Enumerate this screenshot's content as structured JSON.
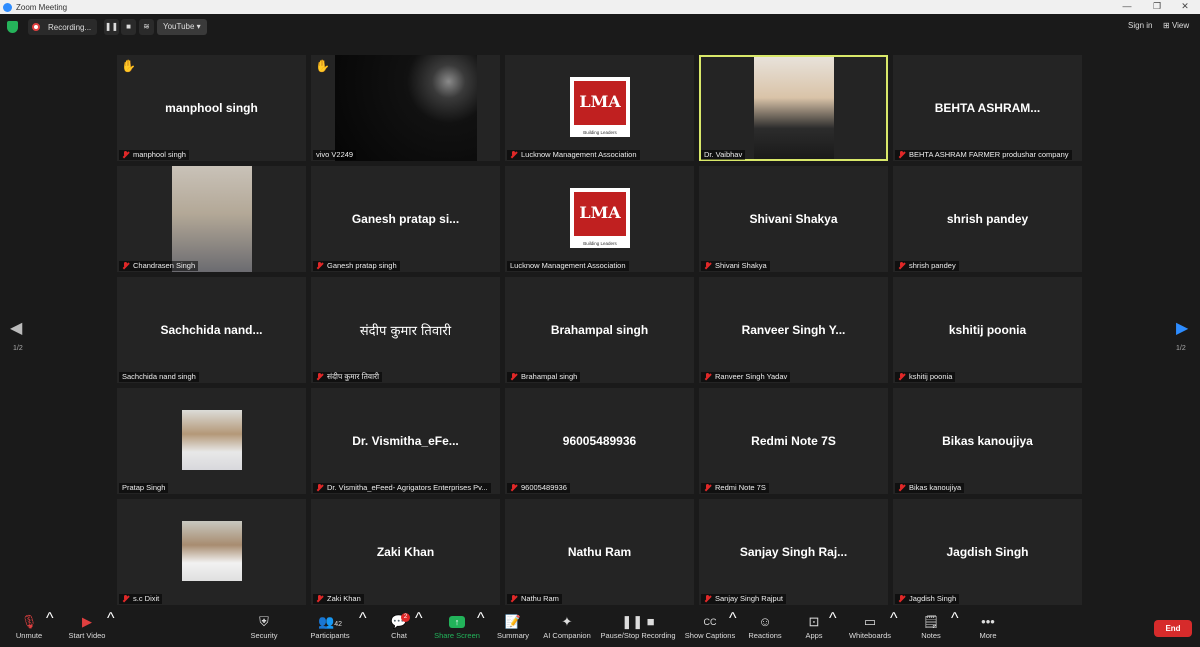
{
  "window": {
    "title": "Zoom Meeting"
  },
  "topbar": {
    "recording_label": "Recording...",
    "stream_label": "YouTube ▾",
    "sign_in": "Sign in",
    "view_label": "View"
  },
  "pager": {
    "left": "1/2",
    "right": "1/2"
  },
  "tiles": [
    {
      "big": "manphool singh",
      "label": "manphool singh",
      "muted": true,
      "hand": true
    },
    {
      "big": "",
      "label": "vivo V2249",
      "muted": false,
      "hand": true
    },
    {
      "big": "",
      "label": "Lucknow Management Association",
      "muted": true,
      "hand": false
    },
    {
      "big": "",
      "label": "Dr. Vaibhav",
      "muted": false,
      "hand": false,
      "active": true
    },
    {
      "big": "BEHTA  ASHRAM...",
      "label": "BEHTA ASHRAM FARMER produshar company",
      "muted": true,
      "hand": false
    },
    {
      "big": "",
      "label": "Chandrasen Singh",
      "muted": true,
      "hand": false
    },
    {
      "big": "Ganesh pratap si...",
      "label": "Ganesh pratap singh",
      "muted": true,
      "hand": false
    },
    {
      "big": "",
      "label": "Lucknow Management Association",
      "muted": false,
      "hand": false
    },
    {
      "big": "Shivani Shakya",
      "label": "Shivani Shakya",
      "muted": true,
      "hand": false
    },
    {
      "big": "shrish pandey",
      "label": "shrish pandey",
      "muted": true,
      "hand": false
    },
    {
      "big": "Sachchida  nand...",
      "label": "Sachchida nand singh",
      "muted": false,
      "hand": false
    },
    {
      "big": "संदीप कुमार तिवारी",
      "label": "संदीप कुमार तिवारी",
      "muted": true,
      "hand": false
    },
    {
      "big": "Brahampal singh",
      "label": "Brahampal singh",
      "muted": true,
      "hand": false
    },
    {
      "big": "Ranveer Singh Y...",
      "label": "Ranveer Singh Yadav",
      "muted": true,
      "hand": false
    },
    {
      "big": "kshitij poonia",
      "label": "kshitij poonia",
      "muted": true,
      "hand": false
    },
    {
      "big": "",
      "label": "Pratap Singh",
      "muted": false,
      "hand": false
    },
    {
      "big": "Dr.  Vismitha_eFe...",
      "label": "Dr. Vismitha_eFeed- Agrigators Enterprises Pv...",
      "muted": true,
      "hand": false
    },
    {
      "big": "96005489936",
      "label": "96005489936",
      "muted": true,
      "hand": false
    },
    {
      "big": "Redmi Note 7S",
      "label": "Redmi Note 7S",
      "muted": true,
      "hand": false
    },
    {
      "big": "Bikas kanoujiya",
      "label": "Bikas kanoujiya",
      "muted": true,
      "hand": false
    },
    {
      "big": "",
      "label": "s.c Dixit",
      "muted": true,
      "hand": false
    },
    {
      "big": "Zaki Khan",
      "label": "Zaki Khan",
      "muted": true,
      "hand": false
    },
    {
      "big": "Nathu Ram",
      "label": "Nathu Ram",
      "muted": true,
      "hand": false
    },
    {
      "big": "Sanjay  Singh  Raj...",
      "label": "Sanjay Singh Rajput",
      "muted": true,
      "hand": false
    },
    {
      "big": "Jagdish Singh",
      "label": "Jagdish Singh",
      "muted": true,
      "hand": false
    }
  ],
  "lma": {
    "logo_text": "LMA",
    "tagline": "Building Leaders"
  },
  "toolbar": {
    "unmute": "Unmute",
    "start_video": "Start Video",
    "security": "Security",
    "participants": "Participants",
    "participants_count": "42",
    "chat": "Chat",
    "chat_badge": "2",
    "share_screen": "Share Screen",
    "summary": "Summary",
    "ai_companion": "AI Companion",
    "pause_stop_recording": "Pause/Stop Recording",
    "show_captions": "Show Captions",
    "reactions": "Reactions",
    "apps": "Apps",
    "whiteboards": "Whiteboards",
    "notes": "Notes",
    "more": "More",
    "end": "End"
  }
}
